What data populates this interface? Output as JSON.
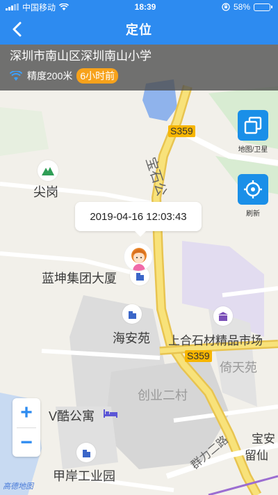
{
  "status": {
    "carrier": "中国移动",
    "time": "18:39",
    "battery": "58%",
    "battery_level": 0.58
  },
  "nav": {
    "title": "定位"
  },
  "info": {
    "address": "深圳市南山区深圳南山小学",
    "accuracy": "精度200米",
    "ago": "6小时前"
  },
  "side": {
    "map_toggle": "地图/卫星",
    "refresh": "刷新"
  },
  "bubble": {
    "timestamp": "2019-04-16 12:03:43"
  },
  "map": {
    "labels": {
      "jiangang": "尖岗",
      "lankun": "蓝坤集团大厦",
      "haian": "海安苑",
      "shanghe": "上合石材精品市场",
      "yitian": "倚天苑",
      "chuangye": "创业二村",
      "vku": "V酷公寓",
      "jiaan": "甲岸工业园",
      "baoan": "宝安",
      "liuxian": "留仙",
      "baoshi": "宝石公",
      "qunli": "群力二路"
    },
    "road_shields": [
      "S359",
      "S359"
    ]
  },
  "zoom": {
    "in": "+",
    "out": "−"
  },
  "brand": "高德地图"
}
